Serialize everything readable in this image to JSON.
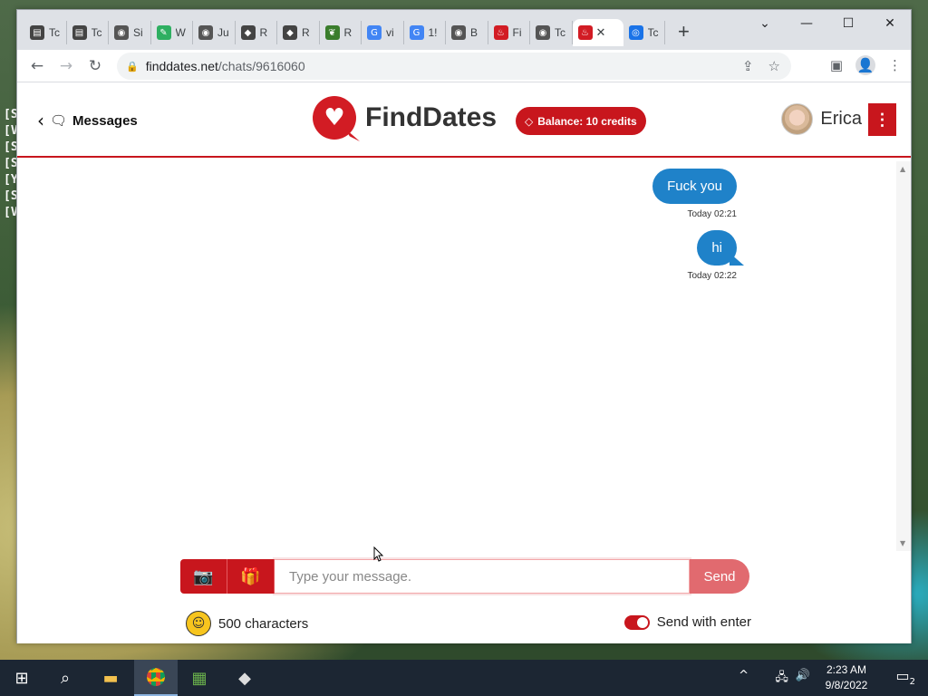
{
  "browser": {
    "tabs": [
      {
        "label": "Tc",
        "icon": "calendar-icon",
        "color": "#444444"
      },
      {
        "label": "Tc",
        "icon": "calendar-icon",
        "color": "#444444"
      },
      {
        "label": "Si",
        "icon": "globe-icon",
        "color": "#555555"
      },
      {
        "label": "W",
        "icon": "link-icon",
        "color": "#2eaf61"
      },
      {
        "label": "Ju",
        "icon": "globe-icon",
        "color": "#555555"
      },
      {
        "label": "R",
        "icon": "roblox-icon",
        "color": "#444444"
      },
      {
        "label": "R",
        "icon": "roblox-icon",
        "color": "#444444"
      },
      {
        "label": "R",
        "icon": "leaf-icon",
        "color": "#3a7d2c"
      },
      {
        "label": "vi",
        "icon": "google-icon",
        "color": "#4285f4"
      },
      {
        "label": "1!",
        "icon": "google-icon",
        "color": "#4285f4"
      },
      {
        "label": "B",
        "icon": "globe-icon",
        "color": "#555555"
      },
      {
        "label": "Fi",
        "icon": "finddates-icon",
        "color": "#d21c24"
      },
      {
        "label": "Tc",
        "icon": "globe-icon",
        "color": "#555555"
      }
    ],
    "active_tab": {
      "icon": "finddates-icon",
      "color": "#d21c24"
    },
    "extra_tab": {
      "label": "Tc",
      "icon": "eye-icon",
      "color": "#1a73e8"
    },
    "new_tab": "+",
    "url_host": "finddates.net",
    "url_path": "/chats/9616060"
  },
  "site": {
    "back_label": "Messages",
    "brand": "FindDates",
    "balance": "Balance: 10 credits",
    "user_name": "Erica",
    "accent": "#c8161d",
    "bubble_color": "#1f82c9"
  },
  "messages": [
    {
      "text": "Fuck you",
      "time": "Today 02:21"
    },
    {
      "text": "hi",
      "time": "Today 02:22"
    }
  ],
  "composer": {
    "placeholder": "Type your message.",
    "send_label": "Send",
    "chars_left": "500 characters",
    "send_with_enter": "Send with enter"
  },
  "taskbar": {
    "time": "2:23 AM",
    "date": "9/8/2022",
    "notifications": "2"
  }
}
